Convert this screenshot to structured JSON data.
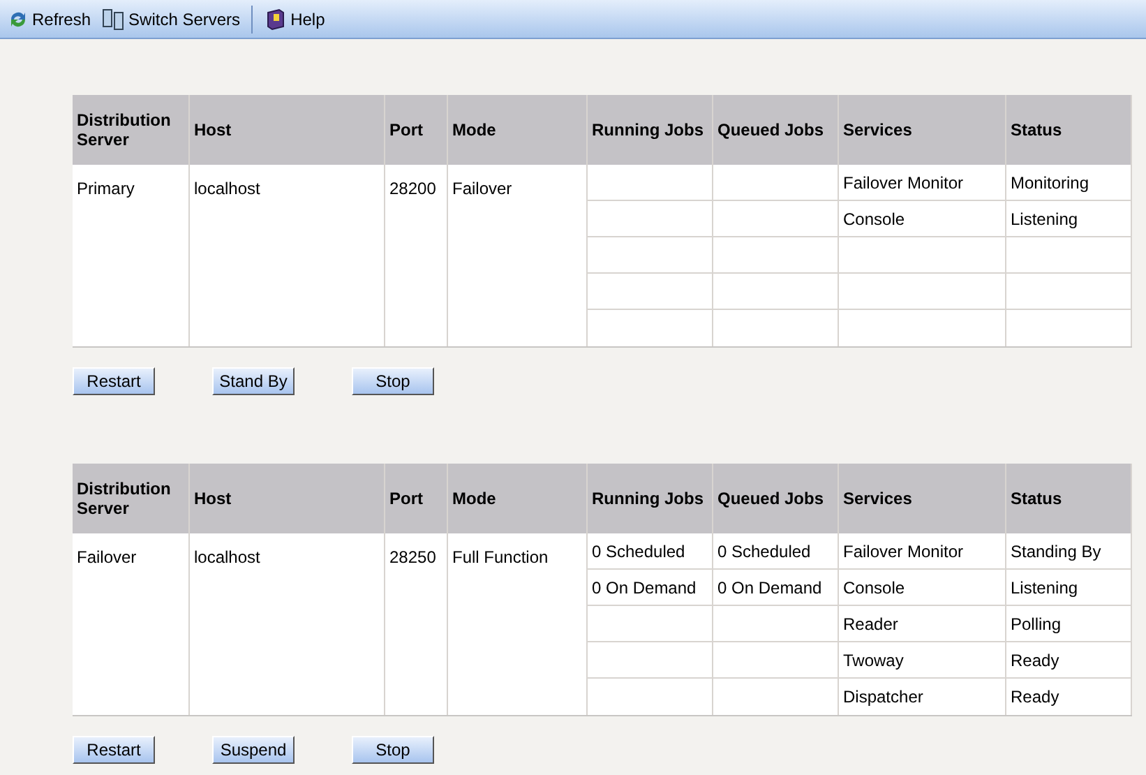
{
  "toolbar": [
    {
      "kind": "refresh",
      "label": "Refresh"
    },
    {
      "kind": "switch",
      "label": "Switch Servers"
    },
    {
      "kind": "separator"
    },
    {
      "kind": "help",
      "label": "Help"
    }
  ],
  "servers": [
    {
      "columns": [
        "Distribution Server",
        "Host",
        "Port",
        "Mode",
        "Running Jobs",
        "Queued Jobs",
        "Services",
        "Status"
      ],
      "name": "Primary",
      "host": "localhost",
      "port": "28200",
      "mode": "Failover",
      "jobs": [
        {
          "service": "Failover Monitor",
          "status": "Monitoring"
        },
        {
          "service": "Console",
          "status": "Listening"
        }
      ],
      "buttons": [
        "Restart",
        "Stand By",
        "Stop"
      ]
    },
    {
      "columns": [
        "Distribution Server",
        "Host",
        "Port",
        "Mode",
        "Running Jobs",
        "Queued Jobs",
        "Services",
        "Status"
      ],
      "name": "Failover",
      "host": "localhost",
      "port": "28250",
      "mode": "Full Function",
      "jobs": [
        {
          "running": "0 Scheduled",
          "queued": "0 Scheduled",
          "service": "Failover Monitor",
          "status": "Standing By"
        },
        {
          "running": "0 On Demand",
          "queued": "0 On Demand",
          "service": "Console",
          "status": "Listening"
        },
        {
          "service": "Reader",
          "status": "Polling"
        },
        {
          "service": "Twoway",
          "status": "Ready"
        },
        {
          "service": "Dispatcher",
          "status": "Ready"
        }
      ],
      "buttons": [
        "Restart",
        "Suspend",
        "Stop"
      ]
    }
  ]
}
